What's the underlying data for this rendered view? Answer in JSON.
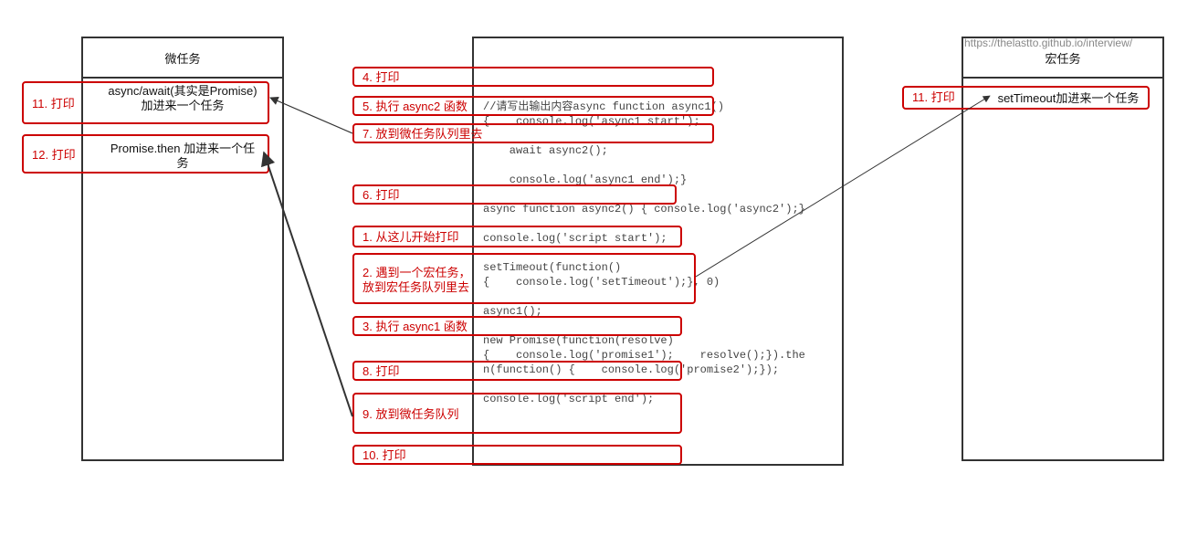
{
  "micro": {
    "title": "微任务",
    "item1": "async/await(其实是Promise)\n加进来一个任务",
    "item2": "Promise.then 加进来一个任\n务"
  },
  "macro": {
    "title": "宏任务",
    "url": "https://thelastto.github.io/interview/",
    "item1": "setTimeout加进来一个任务"
  },
  "steps": {
    "s1": "1. 从这儿开始打印",
    "s2": "2. 遇到一个宏任务，\n放到宏任务队列里去",
    "s3": "3. 执行 async1 函数",
    "s4": "4. 打印",
    "s5": "5. 执行 async2 函数",
    "s6": "6. 打印",
    "s7": "7. 放到微任务队列里去",
    "s8": "8. 打印",
    "s9": "9. 放到微任务队列",
    "s10": "10. 打印",
    "s11a": "11. 打印",
    "s11b": "11. 打印",
    "s12": "12. 打印"
  },
  "code": {
    "l1": "//请写出输出内容async function async1()",
    "l2": "{    console.log('async1 start');",
    "l3": "    await async2();",
    "l4": "    console.log('async1 end');}",
    "l5": "async function async2() { console.log('async2');}",
    "l6": "console.log('script start');",
    "l7": "setTimeout(function()",
    "l8": "{    console.log('setTimeout');}, 0)",
    "l9": "async1();",
    "l10": "new Promise(function(resolve)",
    "l11": "{    console.log('promise1');    resolve();}).the",
    "l12": "n(function() {    console.log('promise2');});",
    "l13": "console.log('script end');"
  }
}
